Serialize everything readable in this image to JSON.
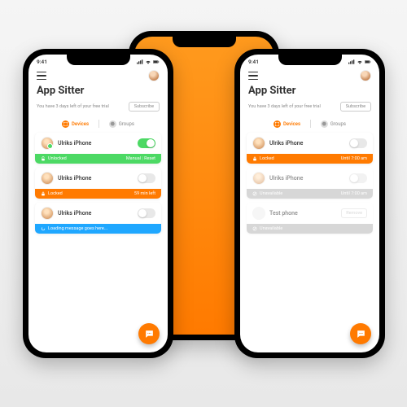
{
  "status": {
    "time": "9:41"
  },
  "header": {
    "title": "App Sitter"
  },
  "trial": {
    "text": "You have 3 days left of your free trial",
    "subscribe": "Subscribe"
  },
  "tabs": {
    "devices": "Devices",
    "groups": "Groups"
  },
  "left_phone": {
    "devices": [
      {
        "name": "Ulriks iPhone",
        "toggle": "on",
        "strip_color": "green",
        "status": "Unlocked",
        "right_a": "Manual",
        "right_b": "Reset"
      },
      {
        "name": "Ulriks iPhone",
        "toggle": "off",
        "strip_color": "orange",
        "status": "Locked",
        "right_a": "59 min left",
        "right_b": ""
      },
      {
        "name": "Ulriks iPhone",
        "toggle": "off",
        "strip_color": "blue",
        "status": "Loading message goes here...",
        "right_a": "",
        "right_b": ""
      }
    ]
  },
  "right_phone": {
    "devices": [
      {
        "name": "Ulriks iPhone",
        "toggle": "off",
        "strip_color": "orange",
        "status": "Locked",
        "right_a": "Until 7:00 am",
        "right_b": "",
        "faded": false
      },
      {
        "name": "Ulriks iPhone",
        "toggle": "off",
        "strip_color": "gray",
        "status": "Unavailable",
        "right_a": "Until 7:00 am",
        "right_b": "",
        "faded": true
      },
      {
        "name": "Test phone",
        "remove": "Remove",
        "strip_color": "gray",
        "status": "Unavailable",
        "right_a": "",
        "right_b": "",
        "faded": true,
        "empty_avatar": true
      }
    ]
  },
  "colors": {
    "accent": "#ff7a00",
    "green": "#4cd964",
    "blue": "#1fa7ff",
    "gray": "#b8b8b8"
  }
}
